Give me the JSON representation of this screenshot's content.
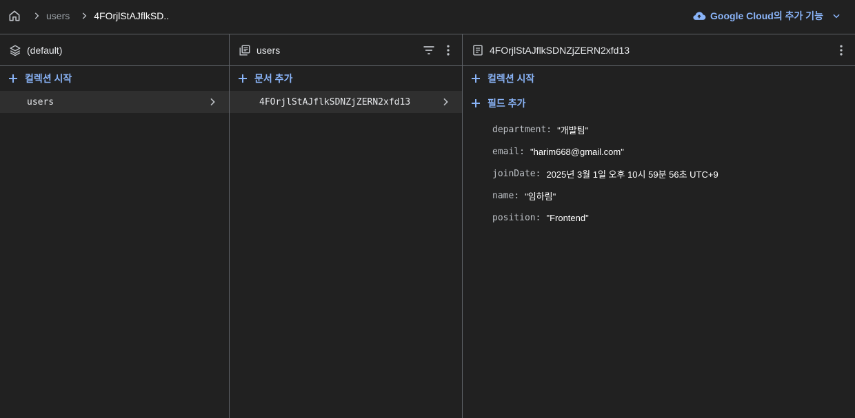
{
  "breadcrumb": {
    "home_icon": "home-icon",
    "items": [
      "users",
      "4FOrjlStAJflkSD.."
    ]
  },
  "header": {
    "extension_label": "Google Cloud의 추가 기능",
    "accent": "#8ab4f8"
  },
  "panel_root": {
    "title": "(default)",
    "icon": "database-stack-icon",
    "add_label": "컬렉션 시작",
    "items": [
      "users"
    ]
  },
  "panel_collection": {
    "title": "users",
    "icon": "collection-icon",
    "add_label": "문서 추가",
    "items": [
      "4FOrjlStAJflkSDNZjZERN2xfd13"
    ]
  },
  "panel_document": {
    "title": "4FOrjlStAJflkSDNZjZERN2xfd13",
    "icon": "document-icon",
    "add_collection_label": "컬렉션 시작",
    "add_field_label": "필드 추가",
    "fields": [
      {
        "key": "department",
        "value": "\"개발팀\""
      },
      {
        "key": "email",
        "value": "\"harim668@gmail.com\""
      },
      {
        "key": "joinDate",
        "value": "2025년 3월 1일 오후 10시 59분 56초 UTC+9"
      },
      {
        "key": "name",
        "value": "\"임하림\""
      },
      {
        "key": "position",
        "value": "\"Frontend\""
      }
    ]
  }
}
